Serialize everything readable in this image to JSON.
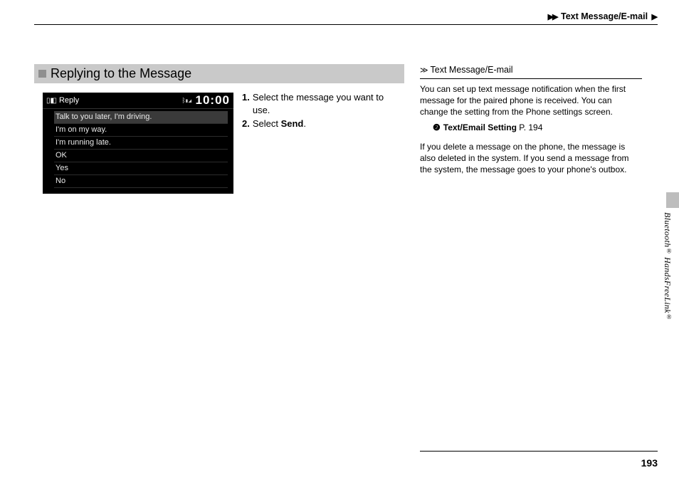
{
  "header": {
    "breadcrumb": "Text Message/E-mail"
  },
  "section": {
    "title": "Replying to the Message"
  },
  "screenshot": {
    "title": "Reply",
    "clock": "10:00",
    "bt_label": "ᛒ▮◢",
    "options": [
      "Talk to you later, I'm driving.",
      "I'm on my way.",
      "I'm running late.",
      "OK",
      "Yes",
      "No"
    ]
  },
  "instructions": {
    "step1_num": "1.",
    "step1_text": "Select the message you want to use.",
    "step2_num": "2.",
    "step2_prefix": "Select ",
    "step2_bold": "Send",
    "step2_suffix": "."
  },
  "sidebar": {
    "heading": "Text Message/E-mail",
    "para1": "You can set up text message notification when the first message for the paired phone is received. You can change the setting from the Phone settings screen.",
    "ref_label": "Text/Email Setting",
    "ref_page": "P. 194",
    "para2": "If you delete a message on the phone, the message is also deleted in the system. If you send a message from the system, the message goes to your phone's outbox."
  },
  "spine": {
    "text1": "Bluetooth",
    "reg1": "®",
    "text2": " HandsFreeLink",
    "reg2": "®"
  },
  "page_number": "193"
}
